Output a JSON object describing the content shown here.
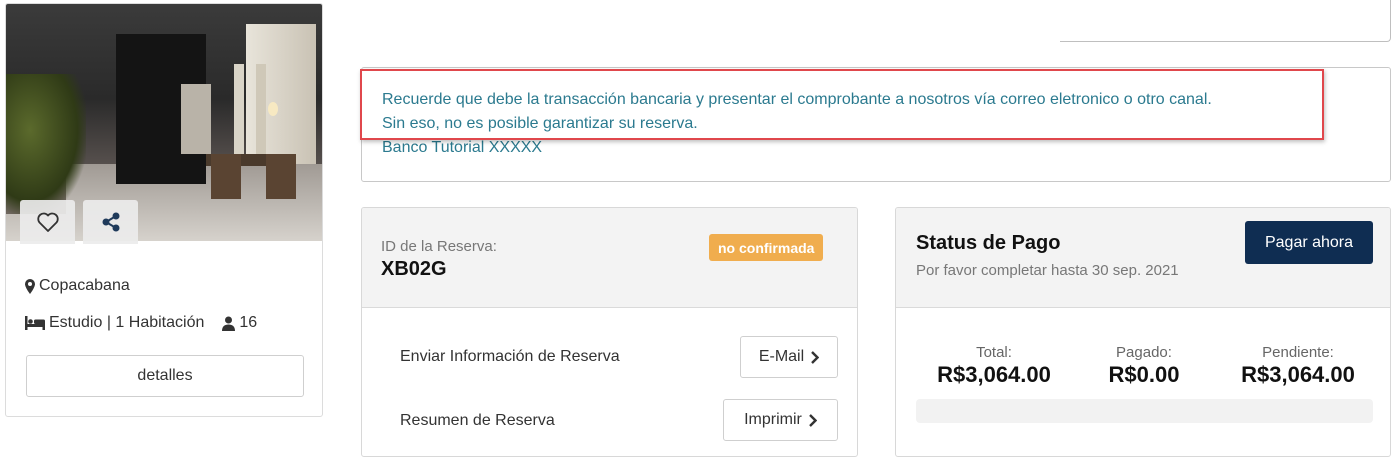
{
  "property": {
    "location": "Copacabana",
    "type_label": "Estudio | 1 Habitación",
    "guests": "16",
    "details_button": "detalles"
  },
  "alert": {
    "line1": "Recuerde que debe la transacción bancaria y presentar el comprobante a nosotros vía correo eletronico o otro canal.",
    "line2": "Sin eso, no es posible garantizar su reserva.",
    "line3": "Banco Tutorial XXXXX"
  },
  "reservation": {
    "id_label": "ID de la Reserva:",
    "id": "XB02G",
    "status_badge": "no confirmada",
    "send_info_label": "Enviar Información de Reserva",
    "email_button": "E-Mail",
    "summary_label": "Resumen de Reserva",
    "print_button": "Imprimir"
  },
  "payment": {
    "title": "Status de Pago",
    "subtitle": "Por favor completar hasta 30 sep. 2021",
    "pay_button": "Pagar ahora",
    "total_label": "Total:",
    "total_value": "R$3,064.00",
    "paid_label": "Pagado:",
    "paid_value": "R$0.00",
    "pending_label": "Pendiente:",
    "pending_value": "R$3,064.00",
    "progress_fraction": 0
  },
  "colors": {
    "alert_text": "#2b7a8f",
    "badge": "#f0ad4e",
    "pay_button": "#0f2d52",
    "highlight": "#e0474c"
  },
  "icons": [
    "heart-icon",
    "share-icon",
    "map-marker-icon",
    "bed-icon",
    "user-icon",
    "chevron-right-icon"
  ]
}
